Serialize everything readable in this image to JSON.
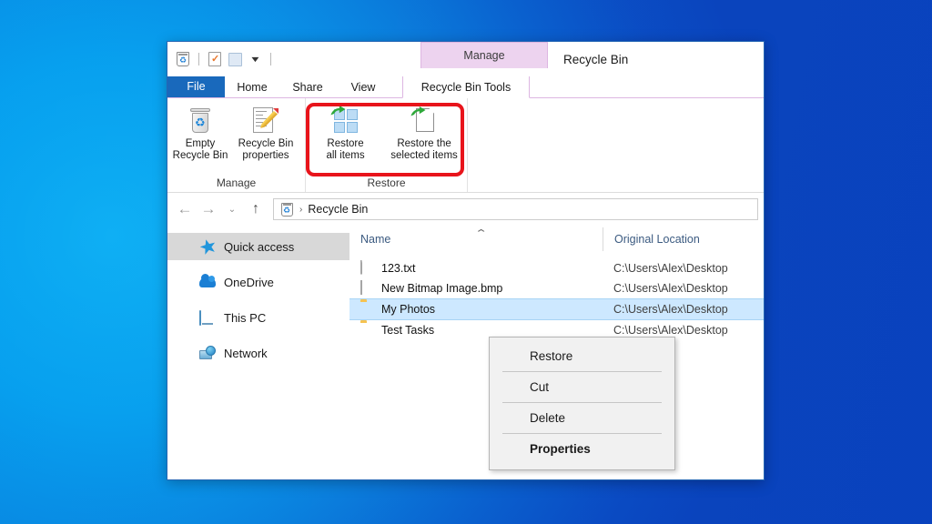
{
  "desktop": {
    "background_left": "#13b4f5",
    "background_right": "#0a46bd"
  },
  "window": {
    "title": "Recycle Bin",
    "contextual_tab_header": "Manage",
    "quick_access_toolbar": [
      {
        "name": "recycle-bin-icon",
        "label": "Recycle Bin"
      },
      {
        "name": "properties-icon",
        "label": "Properties"
      },
      {
        "name": "new-folder-icon",
        "label": "New folder"
      },
      {
        "name": "customize-qat-caret",
        "label": "Customize Quick Access Toolbar"
      }
    ],
    "tabs": [
      {
        "id": "file",
        "label": "File",
        "active": false
      },
      {
        "id": "home",
        "label": "Home",
        "active": false
      },
      {
        "id": "share",
        "label": "Share",
        "active": false
      },
      {
        "id": "view",
        "label": "View",
        "active": false
      },
      {
        "id": "recycle-bin-tools",
        "label": "Recycle Bin Tools",
        "active": true
      }
    ]
  },
  "ribbon": {
    "groups": [
      {
        "id": "manage",
        "label": "Manage",
        "buttons": [
          {
            "id": "empty-recycle-bin",
            "line1": "Empty",
            "line2": "Recycle Bin",
            "icon": "recycle-bin-icon"
          },
          {
            "id": "recycle-bin-properties",
            "line1": "Recycle Bin",
            "line2": "properties",
            "icon": "properties-sheet-pencil-icon"
          }
        ]
      },
      {
        "id": "restore",
        "label": "Restore",
        "highlighted": true,
        "highlight_color": "#e8141b",
        "buttons": [
          {
            "id": "restore-all-items",
            "line1": "Restore",
            "line2": "all items",
            "icon": "restore-all-items-icon"
          },
          {
            "id": "restore-selected-items",
            "line1": "Restore the",
            "line2": "selected items",
            "icon": "restore-selected-items-icon"
          }
        ]
      }
    ]
  },
  "navbar": {
    "back": "←",
    "forward": "→",
    "history": "⌄",
    "up": "↑",
    "address": {
      "icon": "recycle-bin-icon",
      "separator": "›",
      "crumb": "Recycle Bin"
    }
  },
  "navigation_pane": {
    "items": [
      {
        "id": "quick-access",
        "label": "Quick access",
        "icon": "star-icon",
        "selected": true
      },
      {
        "id": "onedrive",
        "label": "OneDrive",
        "icon": "cloud-icon",
        "selected": false
      },
      {
        "id": "this-pc",
        "label": "This PC",
        "icon": "monitor-icon",
        "selected": false
      },
      {
        "id": "network",
        "label": "Network",
        "icon": "network-icon",
        "selected": false
      }
    ]
  },
  "file_list": {
    "columns": [
      {
        "id": "name",
        "label": "Name",
        "sorted": true,
        "sort_caret": "⌃"
      },
      {
        "id": "original-location",
        "label": "Original Location",
        "sorted": false
      }
    ],
    "rows": [
      {
        "name": "123.txt",
        "location": "C:\\Users\\Alex\\Desktop",
        "icon": "text-file-icon",
        "selected": false
      },
      {
        "name": "New Bitmap Image.bmp",
        "location": "C:\\Users\\Alex\\Desktop",
        "icon": "bitmap-file-icon",
        "selected": false
      },
      {
        "name": "My Photos",
        "location": "C:\\Users\\Alex\\Desktop",
        "icon": "folder-icon",
        "selected": true
      },
      {
        "name": "Test Tasks",
        "location": "C:\\Users\\Alex\\Desktop",
        "icon": "folder-icon",
        "selected": false
      }
    ]
  },
  "context_menu": {
    "items": [
      {
        "id": "restore",
        "label": "Restore",
        "bold": false,
        "highlighted": true
      },
      {
        "id": "cut",
        "label": "Cut",
        "bold": false,
        "highlighted": false
      },
      {
        "id": "delete",
        "label": "Delete",
        "bold": false,
        "highlighted": false
      },
      {
        "id": "properties",
        "label": "Properties",
        "bold": true,
        "highlighted": false
      }
    ],
    "highlight_color": "#e8141b"
  }
}
